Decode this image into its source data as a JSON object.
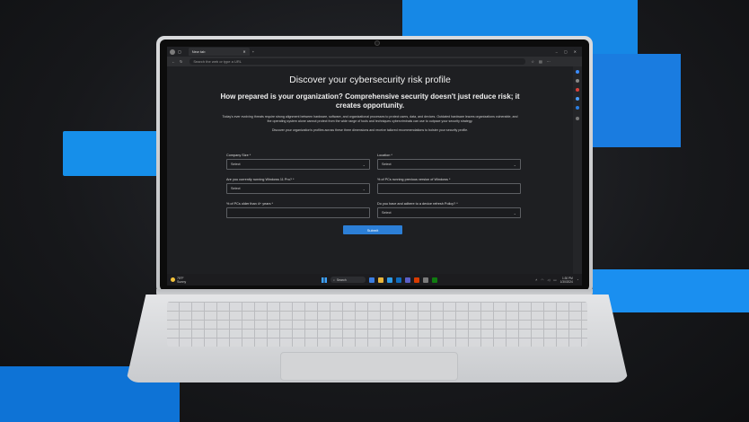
{
  "colors": {
    "accent": "#1688e6",
    "submit": "#2c7fd7",
    "page_bg": "#1e1f22"
  },
  "browser": {
    "tab_title": "New tab",
    "new_tab": "+",
    "address_placeholder": "Search the web or type a URL"
  },
  "page": {
    "title": "Discover your cybersecurity risk profile",
    "subtitle": "How prepared is your organization? Comprehensive security doesn't just reduce risk; it creates opportunity.",
    "paragraph": "Today's ever evolving threats require strong alignment between hardware, software, and organizational processes to protect users, data, and devices. Outdated hardware leaves organizations vulnerable, and the operating system alone cannot protect from the wide range of tools and techniques cybercriminals can use to outpace your security strategy.",
    "paragraph2": "Discover your organization's profiles across these three dimensions and receive tailored recommendations to bolster your security profile.",
    "fields": [
      {
        "label": "Company Size *",
        "value": "Select",
        "type": "select"
      },
      {
        "label": "Location *",
        "value": "Select",
        "type": "select"
      },
      {
        "label": "Are you currently running Windows 11 Pro? *",
        "value": "Select",
        "type": "select"
      },
      {
        "label": "% of PCs running previous version of Windows *",
        "value": "",
        "type": "input"
      },
      {
        "label": "% of PCs older than 4+ years *",
        "value": "",
        "type": "input"
      },
      {
        "label": "Do you have and adhere to a device refresh Policy? *",
        "value": "Select",
        "type": "select"
      }
    ],
    "submit": "Submit"
  },
  "taskbar": {
    "weather_temp": "75°F",
    "weather_text": "Sunny",
    "search_label": "Search",
    "time": "1:30 PM",
    "date": "1/30/2024"
  }
}
